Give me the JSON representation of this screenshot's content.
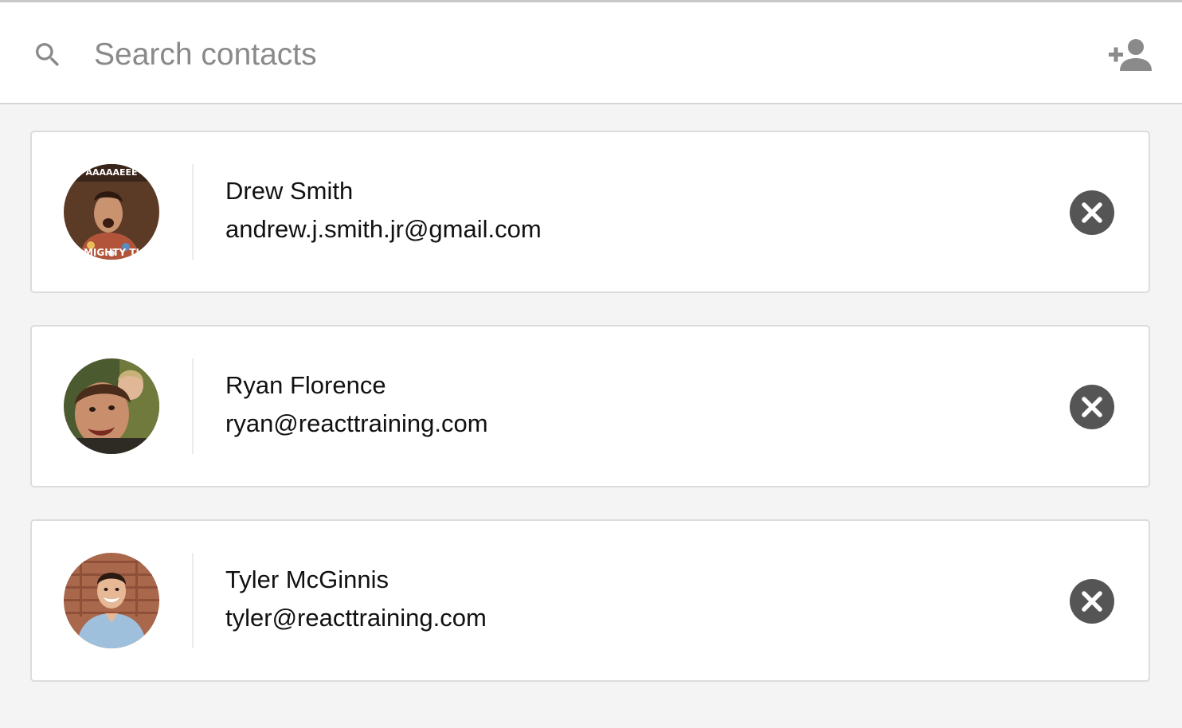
{
  "search": {
    "placeholder": "Search contacts",
    "value": ""
  },
  "toolbar": {
    "add_contact_icon": "person-add-icon"
  },
  "contacts": [
    {
      "name": "Drew Smith",
      "email": "andrew.j.smith.jr@gmail.com",
      "avatar_text_top": "AAAAAEEE",
      "avatar_text_bottom": "MIGHTY TI"
    },
    {
      "name": "Ryan Florence",
      "email": "ryan@reacttraining.com"
    },
    {
      "name": "Tyler McGinnis",
      "email": "tyler@reacttraining.com"
    }
  ],
  "colors": {
    "background": "#f4f4f4",
    "card": "#ffffff",
    "icon": "#8a8a8a",
    "remove_button": "#555555"
  }
}
